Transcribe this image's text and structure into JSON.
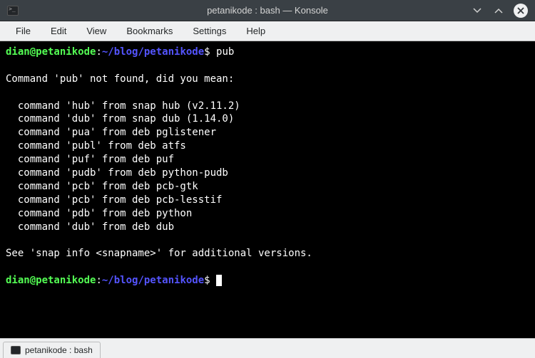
{
  "titlebar": {
    "title": "petanikode : bash — Konsole"
  },
  "menubar": {
    "items": [
      "File",
      "Edit",
      "View",
      "Bookmarks",
      "Settings",
      "Help"
    ]
  },
  "terminal": {
    "prompt_user": "dian@petanikode",
    "prompt_sep": ":",
    "prompt_path": "~/blog/petanikode",
    "prompt_end": "$",
    "command1": "pub",
    "output": "\nCommand 'pub' not found, did you mean:\n\n  command 'hub' from snap hub (v2.11.2)\n  command 'dub' from snap dub (1.14.0)\n  command 'pua' from deb pglistener\n  command 'publ' from deb atfs\n  command 'puf' from deb puf\n  command 'pudb' from deb python-pudb\n  command 'pcb' from deb pcb-gtk\n  command 'pcb' from deb pcb-lesstif\n  command 'pdb' from deb python\n  command 'dub' from deb dub\n\nSee 'snap info <snapname>' for additional versions.\n"
  },
  "tabbar": {
    "tab_label": "petanikode : bash"
  }
}
